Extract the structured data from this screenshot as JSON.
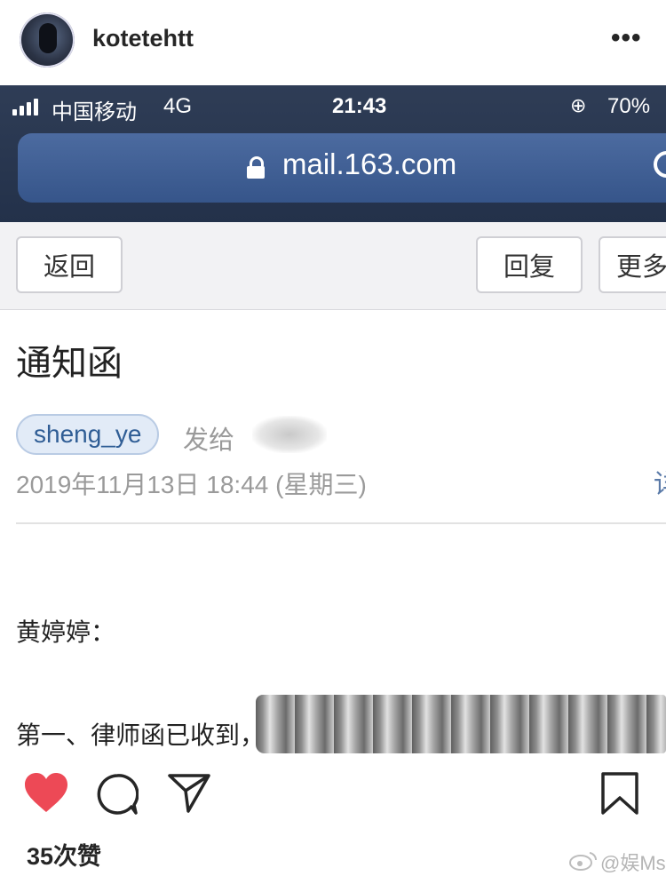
{
  "header": {
    "username": "kotetehtt",
    "more_label": "•••"
  },
  "phone": {
    "status": {
      "carrier": "中国移动",
      "network": "4G",
      "time": "21:43",
      "battery": "70%"
    },
    "url": "mail.163.com",
    "toolbar": {
      "back_label": "返回",
      "reply_label": "回复",
      "more_label": "更多"
    },
    "email": {
      "subject": "通知函",
      "sender": "sheng_ye",
      "send_to_label": "发给",
      "datetime": "2019年11月13日 18:44 (星期三)",
      "detail_label": "详",
      "greeting": "黄婷婷：",
      "body_line1": "第一、律师函已收到，"
    }
  },
  "post": {
    "likes": "35次赞",
    "watermark": "@娱Ms"
  },
  "colors": {
    "heart": "#ed4956",
    "url_bar": "#3f5f95",
    "sender_chip": "#e2ebf7"
  }
}
